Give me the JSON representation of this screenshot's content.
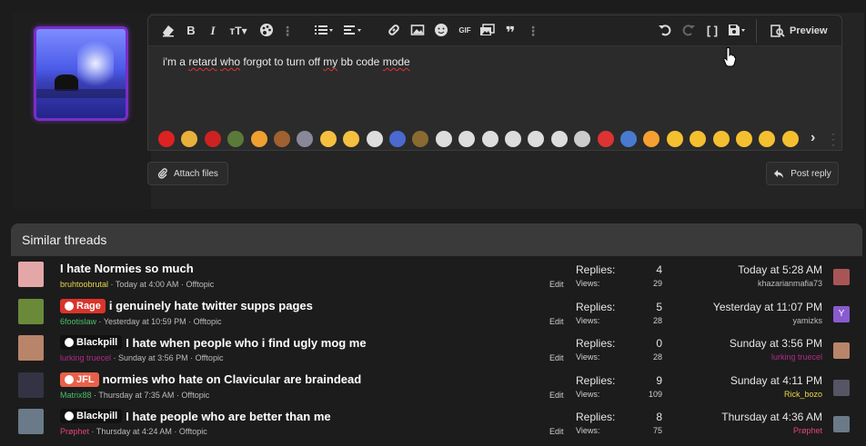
{
  "editor": {
    "text_words": [
      "i'm",
      "a",
      "retard",
      "who",
      "forgot",
      "to",
      "turn",
      "off",
      "my",
      "bb",
      "code",
      "mode"
    ],
    "squiggly": [
      false,
      false,
      true,
      true,
      false,
      false,
      false,
      false,
      true,
      false,
      false,
      true
    ],
    "preview_label": "Preview",
    "toolbar_icons": [
      "eraser-icon",
      "bold-icon",
      "italic-icon",
      "text-size-icon",
      "palette-icon",
      "more-icon",
      "list-icon",
      "align-icon",
      "link-icon",
      "image-icon",
      "smiley-icon",
      "gif-icon",
      "media-icon",
      "quote-icon",
      "more-icon",
      "undo-icon",
      "redo-icon",
      "bbcode-toggle-icon",
      "save-draft-icon"
    ],
    "gif_label": "GIF",
    "emoji_colors": [
      "#d22",
      "#e9b13a",
      "#c22",
      "#5a7a3a",
      "#f0a030",
      "#a06030",
      "#889",
      "#f5c040",
      "#f5c040",
      "#ddd",
      "#4a6ad0",
      "#8a6a30",
      "#ddd",
      "#ddd",
      "#ddd",
      "#ddd",
      "#ddd",
      "#ddd",
      "#ccc",
      "#d33",
      "#4a7ad0",
      "#f5a030",
      "#f5c030",
      "#f5c030",
      "#f5c030",
      "#f5c030",
      "#f5c030",
      "#f5c030"
    ]
  },
  "buttons": {
    "attach": "Attach files",
    "post": "Post reply"
  },
  "similar": {
    "heading": "Similar threads",
    "replies_label": "Replies:",
    "views_label": "Views:",
    "edit_label": "Edit",
    "threads": [
      {
        "prefix": "",
        "prefix_color": "",
        "title": "I hate Normies so much",
        "author": "bruhtoobrutal",
        "author_color": "#e8d84a",
        "date": "Today at 4:00 AM",
        "forum": "Offtopic",
        "replies": "4",
        "views": "29",
        "last_date": "Today at 5:28 AM",
        "last_user": "khazarianmafia73",
        "last_user_color": "#bdbdbd",
        "avatar_color": "#e4a7a7",
        "last_avatar_color": "#a55"
      },
      {
        "prefix": "Rage",
        "prefix_color": "#d9342b",
        "title": "i genuinely hate twitter supps pages",
        "author": "6footislaw",
        "author_color": "#4bbf6b",
        "date": "Yesterday at 10:59 PM",
        "forum": "Offtopic",
        "replies": "5",
        "views": "28",
        "last_date": "Yesterday at 11:07 PM",
        "last_user": "yamizks",
        "last_user_color": "#bdbdbd",
        "avatar_color": "#6a8a3a",
        "last_avatar_color": "#8a5ad0",
        "last_avatar_letter": "Y"
      },
      {
        "prefix": "Blackpill",
        "prefix_color": "#111111",
        "title": "I hate when people who i find ugly mog me",
        "author": "lurking truecel",
        "author_color": "#b02a8a",
        "date": "Sunday at 3:56 PM",
        "forum": "Offtopic",
        "replies": "0",
        "views": "28",
        "last_date": "Sunday at 3:56 PM",
        "last_user": "lurking truecel",
        "last_user_color": "#b02a8a",
        "avatar_color": "#b8856a",
        "last_avatar_color": "#b8856a"
      },
      {
        "prefix": "JFL",
        "prefix_color": "#e8604a",
        "title": "normies who hate on Clavicular are braindead",
        "author": "Matrix88",
        "author_color": "#4bbf6b",
        "date": "Thursday at 7:35 AM",
        "forum": "Offtopic",
        "replies": "9",
        "views": "109",
        "last_date": "Sunday at 4:11 PM",
        "last_user": "Rick_bozo",
        "last_user_color": "#e8d84a",
        "avatar_color": "#334",
        "last_avatar_color": "#556"
      },
      {
        "prefix": "Blackpill",
        "prefix_color": "#111111",
        "title": "I hate people who are better than me",
        "author": "Prøphet",
        "author_color": "#e0457a",
        "date": "Thursday at 4:24 AM",
        "forum": "Offtopic",
        "replies": "8",
        "views": "75",
        "last_date": "Thursday at 4:36 AM",
        "last_user": "Prøphet",
        "last_user_color": "#e0457a",
        "avatar_color": "#6a7a88",
        "last_avatar_color": "#6a7a88"
      }
    ]
  }
}
